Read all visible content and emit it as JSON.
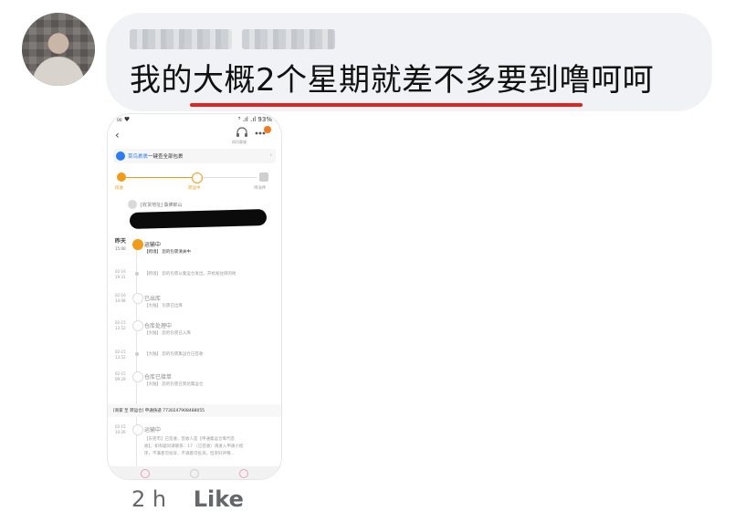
{
  "comment": {
    "text": "我的大概2个星期就差不多要到噜呵呵",
    "underline_color": "#e02424",
    "bubble_color": "#f0f2f5"
  },
  "screenshot": {
    "status_left": "₀₀ ♥",
    "status_right": "⁵ .ıl .ıl 93%",
    "back_icon": "‹",
    "headset_hint": "网问客服",
    "banner": {
      "app_name": "菜鸟裹裹",
      "text": "一键查全部包裹"
    },
    "progress": {
      "labels": [
        "揽收",
        "转运中",
        "待派件"
      ],
      "accent_color": "#f39b17"
    },
    "address_label": "[收货地址] 桑佛郎山",
    "events": [
      {
        "date": "昨天",
        "time": "15:00",
        "title": "运输中",
        "desc": "【跨境】 您的包裹清关中"
      },
      {
        "date": "02-16",
        "time": "19:31",
        "title": "",
        "desc": "【跨境】 您的包裹从集运仓发出，开始发往目的地"
      },
      {
        "date": "02-16",
        "time": "14:08",
        "title": "已出库",
        "desc": "【大陆】 包裹已出库"
      },
      {
        "date": "02-15",
        "time": "13:52",
        "title": "仓库处理中",
        "desc": "【大陆】 您的包裹已入库"
      },
      {
        "date": "02-15",
        "time": "13:52",
        "title": "",
        "desc": "【大陆】 您的包裹集运仓已签收"
      },
      {
        "date": "02-15",
        "time": "09:29",
        "title": "仓库已接单",
        "desc": "【大陆】 您的包裹已到达集运仓"
      }
    ],
    "segment_header": "[商家 至 转运仓] 申通快递 7730247908488055",
    "segment_event": {
      "date": "02-15",
      "time": "10:20",
      "title": "运输中",
      "desc1": "【东莞市】已签收，签收人是【申通集运仓库代签",
      "desc2": "收】，如有疑问请联系：17 （已签收）请进入申通小程",
      "desc3": "序，不满意可投诉，不满意可投诉，但求好评哦..."
    }
  },
  "meta": {
    "time": "2 h",
    "like_label": "Like"
  }
}
